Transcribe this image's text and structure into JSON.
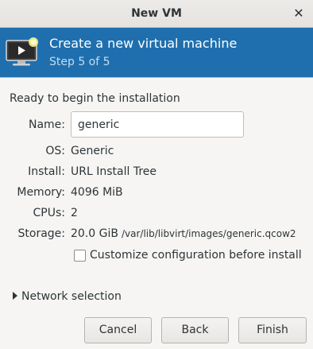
{
  "window": {
    "title": "New VM",
    "close_icon": "close-icon"
  },
  "header": {
    "title": "Create a new virtual machine",
    "step": "Step 5 of 5",
    "icon": "vm-monitor-icon",
    "color": "#1f6fae"
  },
  "summary": {
    "heading": "Ready to begin the installation",
    "name_label": "Name:",
    "name_value": "generic",
    "os_label": "OS:",
    "os_value": "Generic",
    "install_label": "Install:",
    "install_value": "URL Install Tree",
    "memory_label": "Memory:",
    "memory_value": "4096 MiB",
    "cpus_label": "CPUs:",
    "cpus_value": "2",
    "storage_label": "Storage:",
    "storage_size": "20.0 GiB",
    "storage_path": "/var/lib/libvirt/images/generic.qcow2"
  },
  "customize": {
    "label": "Customize configuration before install",
    "checked": false
  },
  "network": {
    "label": "Network selection",
    "expanded": false
  },
  "buttons": {
    "cancel": "Cancel",
    "back": "Back",
    "finish": "Finish"
  }
}
